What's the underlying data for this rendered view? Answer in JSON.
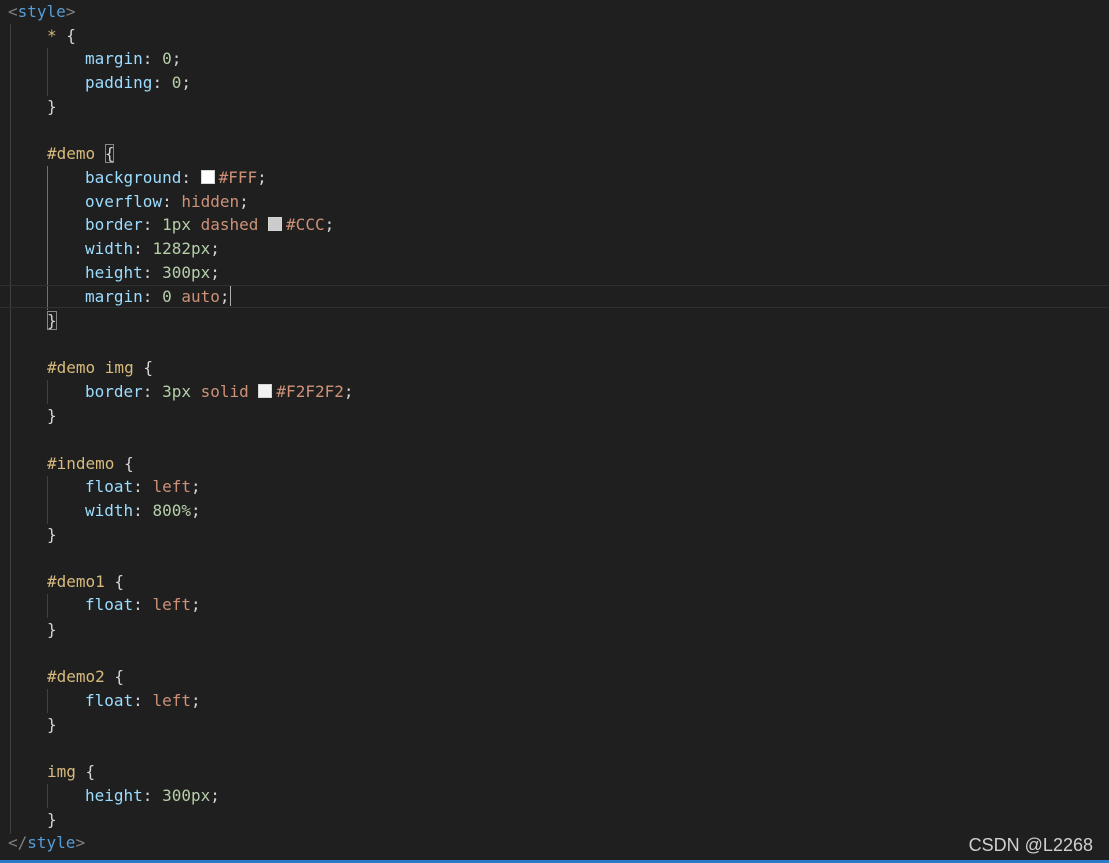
{
  "editor": {
    "open_tag": {
      "open": "<",
      "name": "style",
      "close": ">"
    },
    "close_tag": {
      "open": "</",
      "name": "style",
      "close": ">"
    },
    "rules": [
      {
        "selector": "*",
        "declarations": [
          {
            "prop": "margin",
            "value": "0",
            "kind": "num"
          },
          {
            "prop": "padding",
            "value": "0",
            "kind": "num"
          }
        ]
      },
      {
        "selector": "#demo",
        "declarations": [
          {
            "prop": "background",
            "value": "#FFF",
            "swatch": "#FFFFFF",
            "kind": "val"
          },
          {
            "prop": "overflow",
            "value": "hidden",
            "kind": "val"
          },
          {
            "prop": "border",
            "value1": "1px",
            "value2": "dashed",
            "swatch": "#CCCCCC",
            "value3": "#CCC"
          },
          {
            "prop": "width",
            "value": "1282px",
            "kind": "num"
          },
          {
            "prop": "height",
            "value": "300px",
            "kind": "num"
          },
          {
            "prop": "margin",
            "value1": "0",
            "value2": "auto"
          }
        ]
      },
      {
        "selector": "#demo img",
        "declarations": [
          {
            "prop": "border",
            "value1": "3px",
            "value2": "solid",
            "swatch": "#F2F2F2",
            "value3": "#F2F2F2"
          }
        ]
      },
      {
        "selector": "#indemo",
        "declarations": [
          {
            "prop": "float",
            "value": "left",
            "kind": "val"
          },
          {
            "prop": "width",
            "value": "800%",
            "kind": "num"
          }
        ]
      },
      {
        "selector": "#demo1",
        "declarations": [
          {
            "prop": "float",
            "value": "left",
            "kind": "val"
          }
        ]
      },
      {
        "selector": "#demo2",
        "declarations": [
          {
            "prop": "float",
            "value": "left",
            "kind": "val"
          }
        ]
      },
      {
        "selector": "img",
        "declarations": [
          {
            "prop": "height",
            "value": "300px",
            "kind": "num"
          }
        ]
      }
    ]
  },
  "watermark": "CSDN @L2268",
  "colors": {
    "background": "#1f1f1f",
    "tag": "#569cd6",
    "selector": "#d7ba7d",
    "property": "#9cdcfe",
    "number": "#b5cea8",
    "string_value": "#ce9178",
    "status_bar": "#2b79c9"
  }
}
